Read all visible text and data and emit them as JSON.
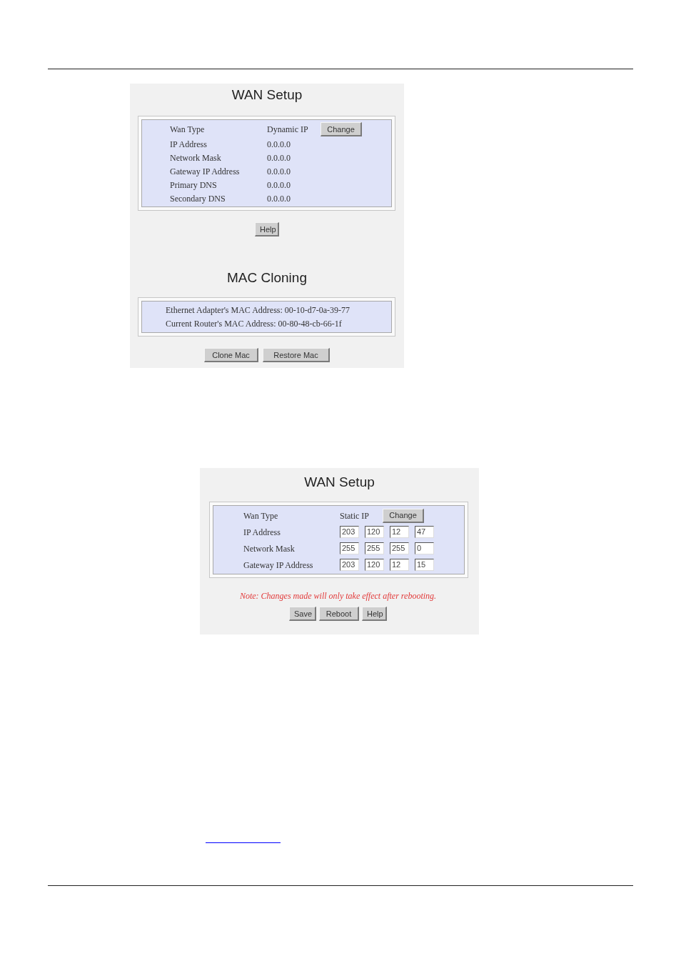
{
  "figure_1": {
    "wan_setup": {
      "title": "WAN Setup",
      "rows": [
        {
          "kind": "text",
          "label": "Wan Type",
          "value": "Dynamic IP",
          "button": "Change"
        },
        {
          "kind": "text",
          "label": "IP Address",
          "value": "0.0.0.0"
        },
        {
          "kind": "text",
          "label": "Network Mask",
          "value": "0.0.0.0"
        },
        {
          "kind": "text",
          "label": "Gateway IP Address",
          "value": "0.0.0.0"
        },
        {
          "kind": "text",
          "label": "Primary DNS",
          "value": "0.0.0.0"
        },
        {
          "kind": "text",
          "label": "Secondary DNS",
          "value": "0.0.0.0"
        }
      ],
      "help_button": "Help"
    },
    "mac_cloning": {
      "title": "MAC Cloning",
      "lines": [
        "Ethernet Adapter's MAC Address: 00-10-d7-0a-39-77",
        "Current Router's MAC Address: 00-80-48-cb-66-1f"
      ],
      "buttons": [
        "Clone Mac",
        "Restore Mac"
      ]
    }
  },
  "figure_2": {
    "wan_setup": {
      "title": "WAN Setup",
      "rows": [
        {
          "kind": "text",
          "label": "Wan Type",
          "value": "Static IP",
          "button": "Change"
        },
        {
          "kind": "octets",
          "label": "IP Address",
          "octets": [
            "203",
            "120",
            "12",
            "47"
          ]
        },
        {
          "kind": "octets",
          "label": "Network Mask",
          "octets": [
            "255",
            "255",
            "255",
            "0"
          ]
        },
        {
          "kind": "octets",
          "label": "Gateway IP Address",
          "octets": [
            "203",
            "120",
            "12",
            "15"
          ]
        }
      ]
    },
    "note": "Note: Changes made will only take effect after rebooting.",
    "buttons": [
      "Save",
      "Reboot",
      "Help"
    ]
  }
}
